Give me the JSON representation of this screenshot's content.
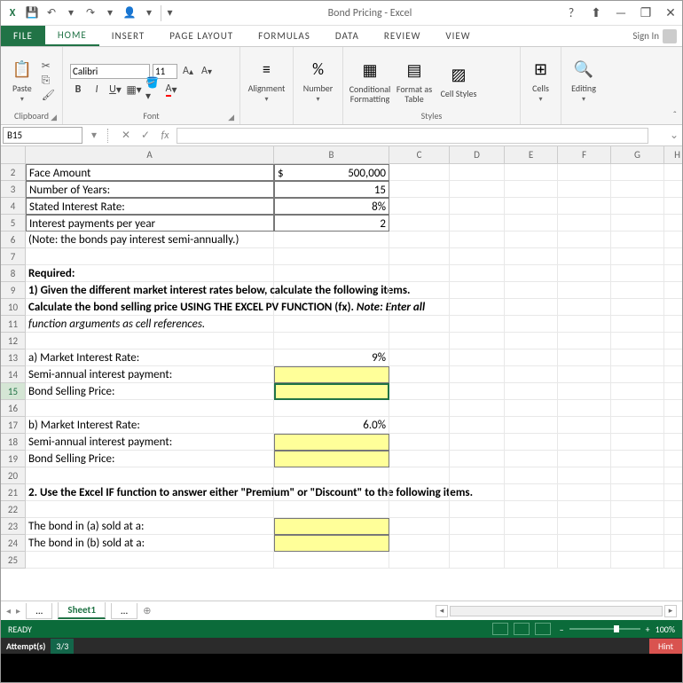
{
  "app": {
    "title": "Bond Pricing - Excel",
    "signin": "Sign In"
  },
  "qat": {
    "save": "💾",
    "undo": "↶",
    "redo": "↷",
    "user": "👤"
  },
  "win": {
    "help": "?",
    "ropt": "⬆",
    "min": "—",
    "max": "❐",
    "close": "✕"
  },
  "tabs": {
    "file": "FILE",
    "home": "HOME",
    "insert": "INSERT",
    "pagelayout": "PAGE LAYOUT",
    "formulas": "FORMULAS",
    "data": "DATA",
    "review": "REVIEW",
    "view": "VIEW"
  },
  "ribbon": {
    "clipboard": {
      "paste": "Paste",
      "label": "Clipboard"
    },
    "font": {
      "name": "Calibri",
      "size": "11",
      "label": "Font"
    },
    "alignment": {
      "button": "Alignment"
    },
    "number": {
      "button": "Number",
      "glyph": "%"
    },
    "styles": {
      "cond": "Conditional Formatting",
      "format": "Format as Table",
      "cell": "Cell Styles",
      "label": "Styles"
    },
    "cells": {
      "button": "Cells"
    },
    "editing": {
      "button": "Editing"
    }
  },
  "fbar": {
    "name": "B15",
    "fx": "fx",
    "value": ""
  },
  "cols": [
    "A",
    "B",
    "C",
    "D",
    "E",
    "F",
    "G",
    "H"
  ],
  "rows_start": 2,
  "cells": {
    "A2": "Face Amount",
    "B2_pre": "$",
    "B2": "500,000",
    "A3": "Number of Years:",
    "B3": "15",
    "A4": "Stated Interest Rate:",
    "B4": "8%",
    "A5": "Interest payments per year",
    "B5": "2",
    "A6": "(Note: the bonds pay interest semi-annually.)",
    "A8": "Required:",
    "A9": "1) Given the different market interest rates below, calculate the following items.",
    "A10": "Calculate the bond selling price USING THE EXCEL PV FUNCTION (fx). ",
    "A10_tail": "Note: Enter all",
    "A11": "function arguments as cell references.",
    "A13": "a)  Market Interest Rate:",
    "B13": "9%",
    "A14": "      Semi-annual interest payment:",
    "A15": "      Bond Selling Price:",
    "A17": "b)  Market Interest Rate:",
    "B17": "6.0%",
    "A18": "      Semi-annual interest payment:",
    "A19": "      Bond Selling Price:",
    "A21": "2. Use the Excel IF function to answer either \"Premium\" or \"Discount\" to the following items.",
    "A23": "The bond in (a) sold at a:",
    "A24": "The bond in (b) sold at a:"
  },
  "sheettabs": {
    "dots": "...",
    "sheet1": "Sheet1",
    "plus": "⊕"
  },
  "status": {
    "ready": "READY",
    "zoom": "100%"
  },
  "attempts": {
    "label": "Attempt(s)",
    "value": "3/3",
    "hint": "Hint"
  }
}
